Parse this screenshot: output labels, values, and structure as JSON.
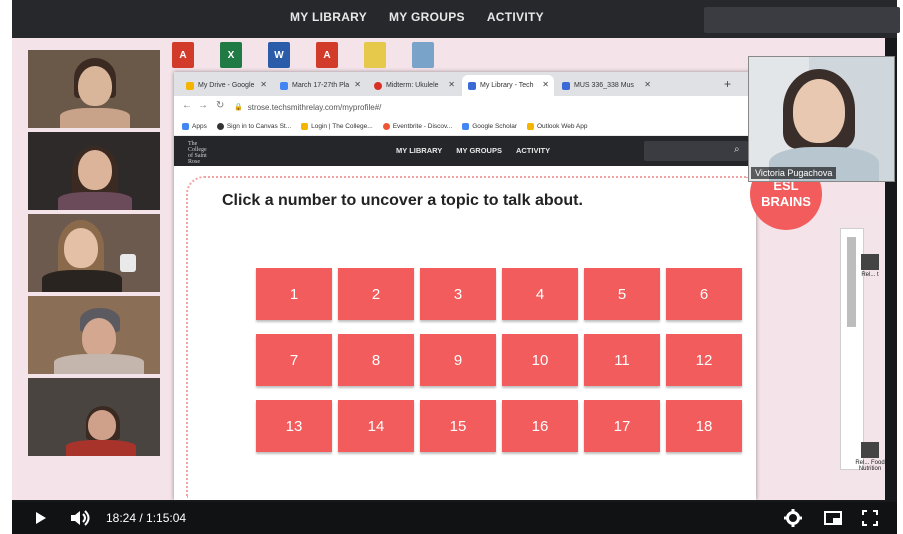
{
  "player": {
    "nav": [
      "MY LIBRARY",
      "MY GROUPS",
      "ACTIVITY"
    ],
    "time": "18:24 / 1:15:04"
  },
  "desktop_icons": [
    {
      "label": "A",
      "color": "#d23a2a"
    },
    {
      "label": "X",
      "color": "#1f7a43"
    },
    {
      "label": "W",
      "color": "#2a5caa"
    },
    {
      "label": "A",
      "color": "#d23a2a"
    },
    {
      "label": "",
      "color": "#e6c84a"
    },
    {
      "label": "",
      "color": "#7aa3c9"
    }
  ],
  "browser": {
    "tabs": [
      {
        "title": "My Drive - Google",
        "color": "#f4b400"
      },
      {
        "title": "March 17-27th Pla",
        "color": "#4285f4"
      },
      {
        "title": "Midterm: Ukulele",
        "color": "#d93025"
      },
      {
        "title": "My Library - Tech",
        "color": "#3b6ad6",
        "active": true
      },
      {
        "title": "MUS 336_338 Mus",
        "color": "#3b6ad6"
      }
    ],
    "url": "strose.techsmithrelay.com/myprofile#/",
    "bookmarks": [
      {
        "label": "Apps",
        "color": "#4285f4"
      },
      {
        "label": "Sign in to Canvas St...",
        "color": "#333333"
      },
      {
        "label": "Login | The College...",
        "color": "#f4b400"
      },
      {
        "label": "Eventbrite - Discov...",
        "color": "#f05537"
      },
      {
        "label": "Google Scholar",
        "color": "#4285f4"
      },
      {
        "label": "Outlook Web App",
        "color": "#f4b400"
      }
    ],
    "site_logo": [
      "The",
      "College",
      "of Saint",
      "Rose"
    ],
    "site_nav": [
      "MY LIBRARY",
      "MY GROUPS",
      "ACTIVITY"
    ]
  },
  "game": {
    "prompt": "Click a number to uncover a topic to talk about.",
    "tiles": [
      "1",
      "2",
      "3",
      "4",
      "5",
      "6",
      "7",
      "8",
      "9",
      "10",
      "11",
      "12",
      "13",
      "14",
      "15",
      "16",
      "17",
      "18"
    ],
    "badge_line1": "ESL",
    "badge_line2": "BRAINS",
    "accent": "#f25c5c"
  },
  "presenter": {
    "name": "Victoria Pugachova"
  },
  "right_side": [
    "Rel... t",
    "Rel... Food Nutrition"
  ],
  "icons": {
    "play": "play-icon",
    "volume": "volume-icon",
    "settings": "gear-icon",
    "miniplayer": "miniplayer-icon",
    "fullscreen": "fullscreen-icon"
  }
}
